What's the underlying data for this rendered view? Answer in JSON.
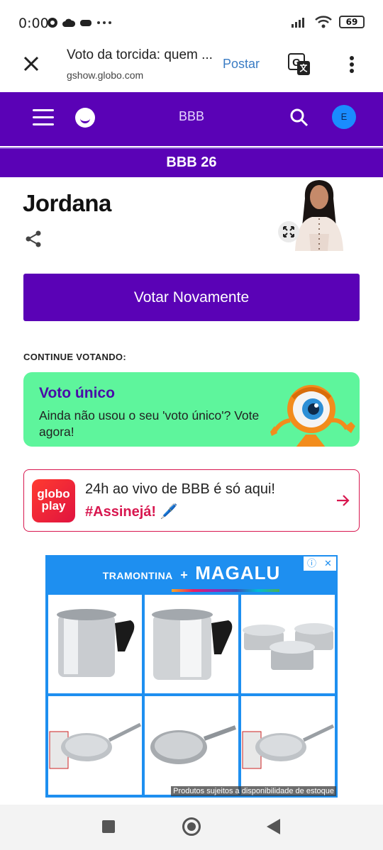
{
  "status_bar": {
    "time": "0:00",
    "battery": "69"
  },
  "browser": {
    "page_title": "Voto da torcida: quem ...",
    "url": "gshow.globo.com",
    "post_label": "Postar"
  },
  "site_header": {
    "title": "BBB",
    "avatar_letter": "E",
    "subheader": "BBB 26"
  },
  "candidate": {
    "name": "Jordana"
  },
  "vote_button": {
    "label": "Votar Novamente"
  },
  "continue": {
    "label": "CONTINUE VOTANDO:",
    "card_title": "Voto único",
    "card_desc": "Ainda não usou o seu 'voto único'? Vote agora!"
  },
  "globoplay": {
    "logo_line1": "globo",
    "logo_line2": "play",
    "text": "24h ao vivo de BBB é só aqui!",
    "cta": "#Assinejá! 🖊️"
  },
  "ad": {
    "brand_left": "TRAMONTINA",
    "brand_plus": "+",
    "brand_right": "MAGALU",
    "disclaimer": "Produtos sujeitos a disponibilidade de estoque"
  },
  "colors": {
    "primary": "#5a02b6",
    "voto_card": "#5ef59c",
    "globo_red": "#d8174f",
    "ad_blue": "#1e8ff0"
  },
  "icons": [
    "close-icon",
    "translate-icon",
    "more-vert-icon",
    "menu-icon",
    "search-icon",
    "share-icon",
    "expand-icon",
    "arrow-right-icon",
    "adchoices-icon",
    "ad-close-icon"
  ]
}
